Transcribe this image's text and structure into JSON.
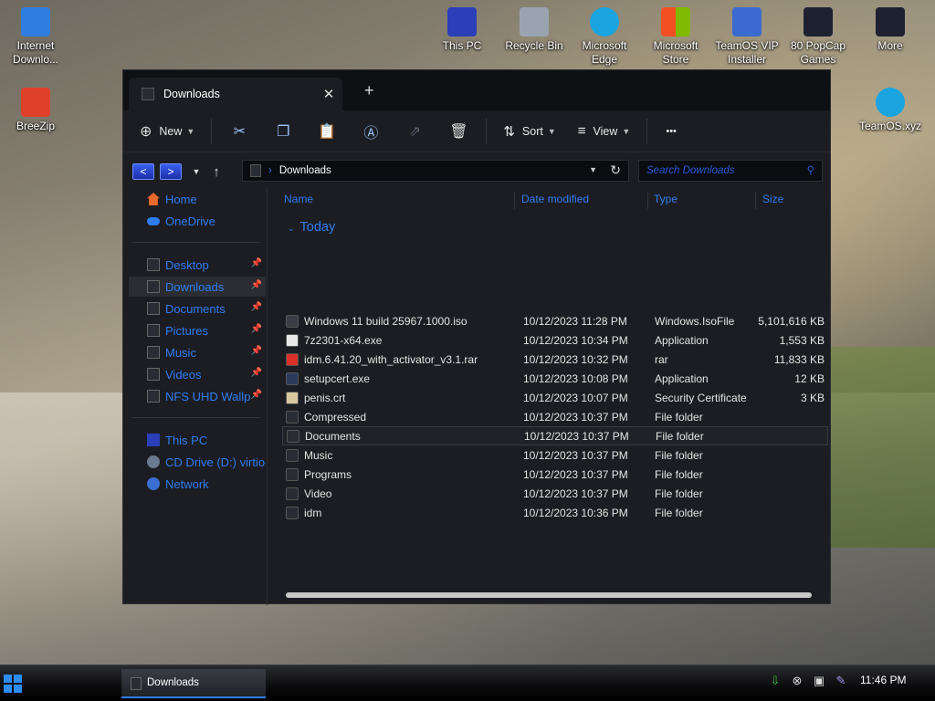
{
  "desktop": {
    "icons": [
      {
        "label": "Internet Downlo...",
        "color": "#2f7de0"
      },
      {
        "label": "BreeZip",
        "color": "#e0402a"
      },
      {
        "label": "This PC",
        "color": "#2b3fb8"
      },
      {
        "label": "Recycle Bin",
        "color": "#9aa3b0"
      },
      {
        "label": "Microsoft Edge",
        "color": "#1aa5e0"
      },
      {
        "label": "Microsoft Store",
        "color": "#f0f0f0"
      },
      {
        "label": "TeamOS VIP Installer",
        "color": "#3b6ad0"
      },
      {
        "label": "80 PopCap Games",
        "color": "#1c2230"
      },
      {
        "label": "More",
        "color": "#1c2230"
      },
      {
        "label": "TeamOS.xyz",
        "color": "#1aa5e0"
      }
    ]
  },
  "window": {
    "tab_title": "Downloads",
    "tab_close": "✕",
    "new_tab": "+",
    "toolbar": {
      "new_label": "New",
      "sort_label": "Sort",
      "view_label": "View",
      "more_label": "•••"
    },
    "address": {
      "path": "Downloads",
      "search_placeholder": "Search Downloads"
    },
    "sidebar": {
      "home": "Home",
      "onedrive": "OneDrive",
      "quick": [
        "Desktop",
        "Downloads",
        "Documents",
        "Pictures",
        "Music",
        "Videos",
        "NFS UHD Wallp"
      ],
      "this_pc": "This PC",
      "cd_drive": "CD Drive (D:) virtio-",
      "network": "Network"
    },
    "columns": {
      "name": "Name",
      "date": "Date modified",
      "type": "Type",
      "size": "Size"
    },
    "group": "Today",
    "files": [
      {
        "name": "Windows 11 build 25967.1000.iso",
        "date": "10/12/2023 11:28 PM",
        "type": "Windows.IsoFile",
        "size": "5,101,616 KB",
        "icon": "#3a3d44"
      },
      {
        "name": "7z2301-x64.exe",
        "date": "10/12/2023 10:34 PM",
        "type": "Application",
        "size": "1,553 KB",
        "icon": "#e8e8e8"
      },
      {
        "name": "idm.6.41.20_with_activator_v3.1.rar",
        "date": "10/12/2023 10:32 PM",
        "type": "rar",
        "size": "11,833 KB",
        "icon": "#d9302a"
      },
      {
        "name": "setupcert.exe",
        "date": "10/12/2023 10:08 PM",
        "type": "Application",
        "size": "12 KB",
        "icon": "#2b3a5c"
      },
      {
        "name": "penis.crt",
        "date": "10/12/2023 10:07 PM",
        "type": "Security Certificate",
        "size": "3 KB",
        "icon": "#d8c8a0"
      },
      {
        "name": "Compressed",
        "date": "10/12/2023 10:37 PM",
        "type": "File folder",
        "size": "",
        "icon": "#2a2c33"
      },
      {
        "name": "Documents",
        "date": "10/12/2023 10:37 PM",
        "type": "File folder",
        "size": "",
        "icon": "#2a2c33"
      },
      {
        "name": "Music",
        "date": "10/12/2023 10:37 PM",
        "type": "File folder",
        "size": "",
        "icon": "#2a2c33"
      },
      {
        "name": "Programs",
        "date": "10/12/2023 10:37 PM",
        "type": "File folder",
        "size": "",
        "icon": "#2a2c33"
      },
      {
        "name": "Video",
        "date": "10/12/2023 10:37 PM",
        "type": "File folder",
        "size": "",
        "icon": "#2a2c33"
      },
      {
        "name": "idm",
        "date": "10/12/2023 10:36 PM",
        "type": "File folder",
        "size": "",
        "icon": "#2a2c33"
      }
    ],
    "selected_row": 6
  },
  "taskbar": {
    "app_label": "Downloads",
    "clock": "11:46 PM",
    "accent": "#2f7df0"
  }
}
